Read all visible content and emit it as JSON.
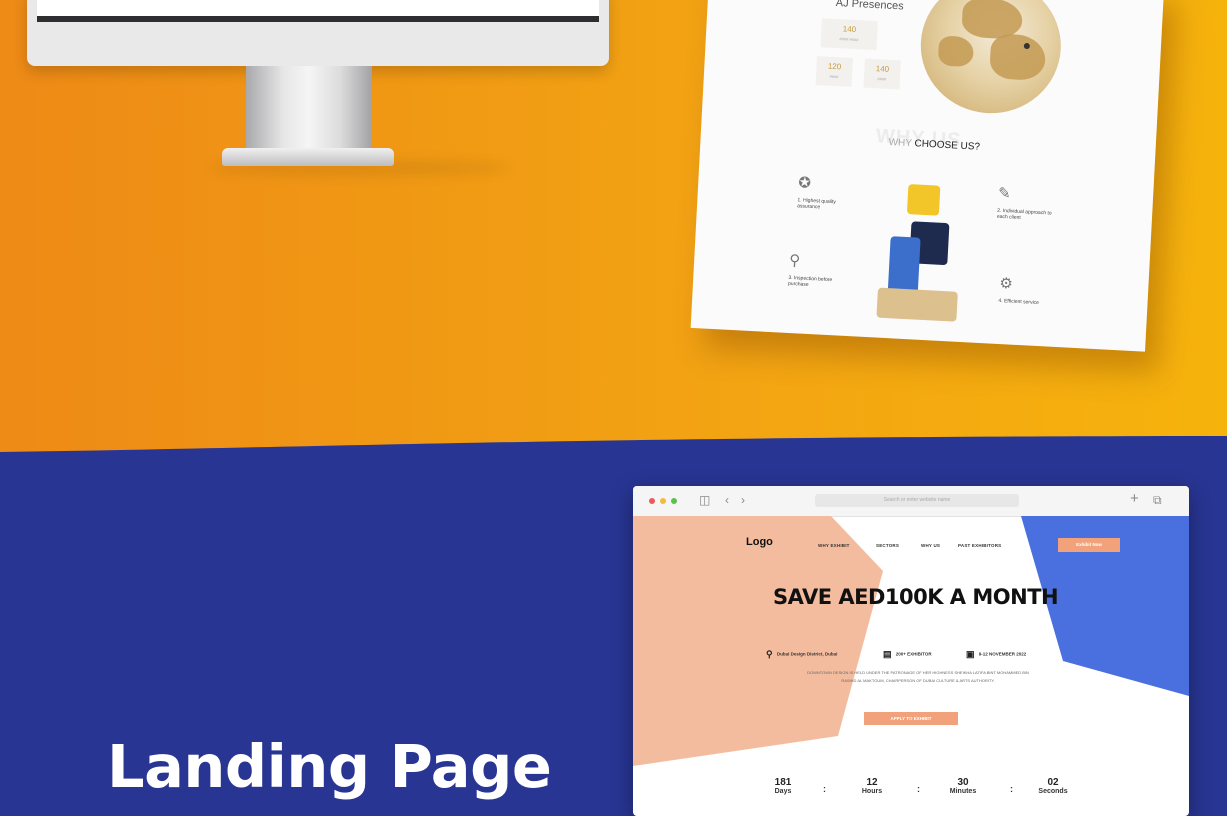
{
  "colors": {
    "orange_top": "#ee8a16",
    "yellow_top": "#f6b30c",
    "navy": "#283592",
    "peach": "#f2a27a",
    "blue_shape": "#4a6fdf",
    "salmon_shape": "#f4bc9e"
  },
  "showcase_page": {
    "presence_title": "AJ Presences",
    "stats": [
      {
        "value": "140",
        "caption": "#### ####"
      },
      {
        "value": "120",
        "caption": "####"
      },
      {
        "value": "140",
        "caption": "####"
      }
    ],
    "why_title_ghost": "WHY US",
    "why_title_light": "WHY",
    "why_title_bold": "CHOOSE US?",
    "features": [
      {
        "icon": "award-icon",
        "label": "1. Highest quality assurance"
      },
      {
        "icon": "document-check-icon",
        "label": "2. Individual approach to each client"
      },
      {
        "icon": "inspection-icon",
        "label": "3. Inspection before purchase"
      },
      {
        "icon": "service-icon",
        "label": "4. Efficient service"
      }
    ]
  },
  "section_title": "Landing Page",
  "browser": {
    "url_placeholder": "Search or enter website name"
  },
  "landing": {
    "logo": "Logo",
    "nav": [
      "WHY EXHIBIT",
      "SECTORS",
      "WHY US",
      "PAST EXHIBITORS"
    ],
    "exhibit_button": "Exhibit Now",
    "hero_title": "SAVE AED100K A MONTH",
    "location": "Dubai Design District, Dubai",
    "exhibitors": "200+ EXHIBITOR",
    "dates": "9-12 NOVEMBER 2022",
    "description": "DOWNTOWN DESIGN IS HELD UNDER THE PATRONAGE OF HER HIGHNESS SHEIKHA LATIFA BINT MOHAMMED BIN RASHID AL MAKTOUM, CHAIRPERSON OF DUBAI CULTURE & ARTS AUTHORITY.",
    "apply_button": "APPLY TO EXHIBIT",
    "countdown": [
      {
        "value": "181",
        "label": "Days"
      },
      {
        "value": "12",
        "label": "Hours"
      },
      {
        "value": "30",
        "label": "Minutes"
      },
      {
        "value": "02",
        "label": "Seconds"
      }
    ]
  }
}
